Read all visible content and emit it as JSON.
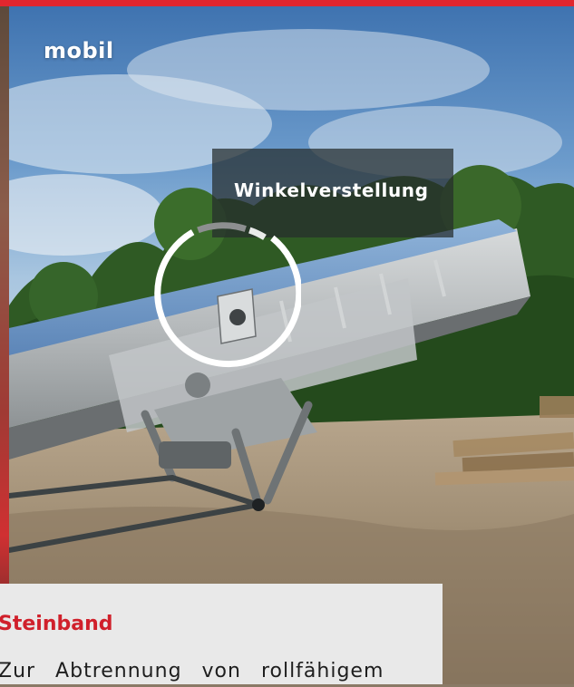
{
  "photo": {
    "badge_label": "mobil",
    "callout_label": "Winkelverstellung"
  },
  "info": {
    "heading": "Steinband",
    "body_text": "Zur Abtrennung von rollfähigem"
  },
  "colors": {
    "accent_red": "#e2262e",
    "callout_bg": "#262c2c",
    "panel_bg": "#e9e9e9"
  },
  "icons": {
    "highlight_ring": "ring-highlight-icon"
  }
}
